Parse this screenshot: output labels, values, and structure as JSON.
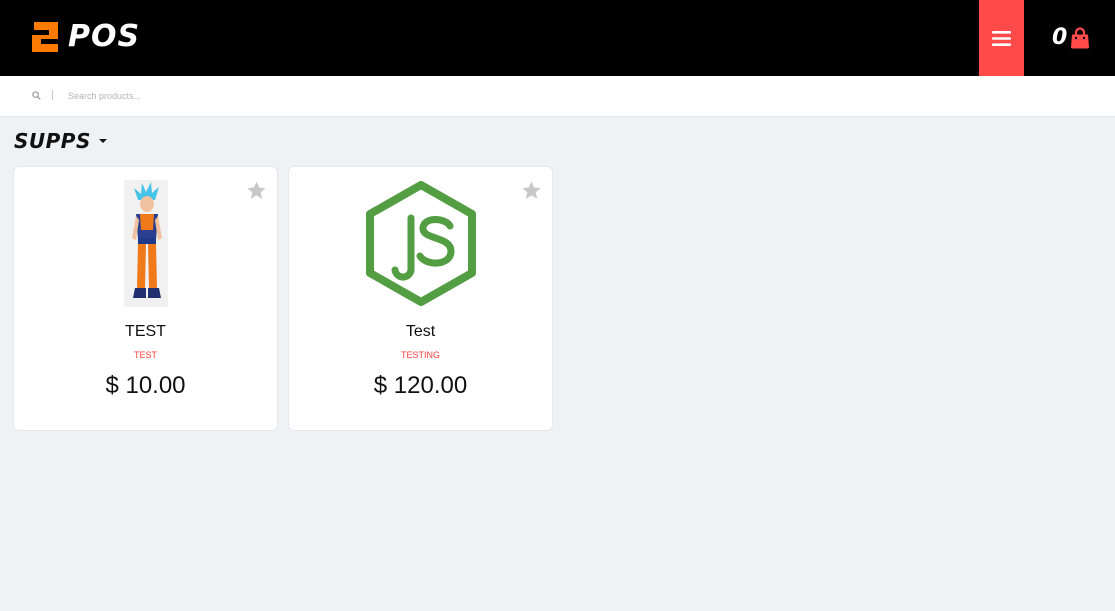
{
  "app": {
    "title": "POS"
  },
  "header": {
    "cart_count": "0"
  },
  "search": {
    "placeholder": "Search products..."
  },
  "category": {
    "label": "SUPPS"
  },
  "products": [
    {
      "name": "TEST",
      "tag": "TEST",
      "price": "$ 10.00",
      "image": "goku-figure-image"
    },
    {
      "name": "Test",
      "tag": "TESTING",
      "price": "$ 120.00",
      "image": "nodejs-logo-image"
    }
  ],
  "colors": {
    "accent": "#ff4a4a",
    "logo": "#ff7a00",
    "background": "#eff2f5",
    "nodejs": "#539e43",
    "star": "#c8c8c8"
  }
}
